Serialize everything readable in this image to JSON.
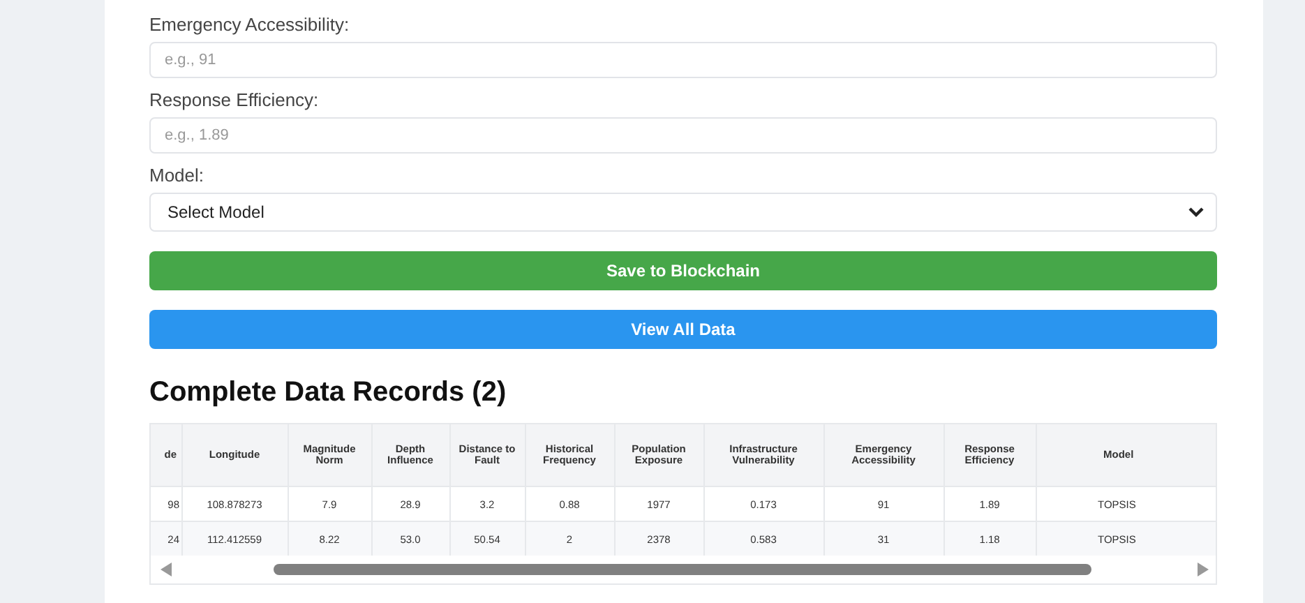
{
  "fields": [
    {
      "kind": "input",
      "label": "Emergency Accessibility:",
      "placeholder": "e.g., 91"
    },
    {
      "kind": "input",
      "label": "Response Efficiency:",
      "placeholder": "e.g., 1.89"
    },
    {
      "kind": "select",
      "label": "Model:",
      "value": "Select Model"
    }
  ],
  "buttons": [
    {
      "label": "Save to Blockchain",
      "color": "#46a749"
    },
    {
      "label": "View All Data",
      "color": "#2a95ef"
    }
  ],
  "records": {
    "title": "Complete Data Records (2)",
    "columns": [
      "de",
      "Longitude",
      "Magnitude Norm",
      "Depth Influence",
      "Distance to Fault",
      "Historical Frequency",
      "Population Exposure",
      "Infrastructure Vulnerability",
      "Emergency Accessibility",
      "Response Efficiency",
      "Model"
    ],
    "rows": [
      [
        "98",
        "108.878273",
        "7.9",
        "28.9",
        "3.2",
        "0.88",
        "1977",
        "0.173",
        "91",
        "1.89",
        "TOPSIS"
      ],
      [
        "24",
        "112.412559",
        "8.22",
        "53.0",
        "50.54",
        "2",
        "2378",
        "0.583",
        "31",
        "1.18",
        "TOPSIS"
      ]
    ]
  }
}
